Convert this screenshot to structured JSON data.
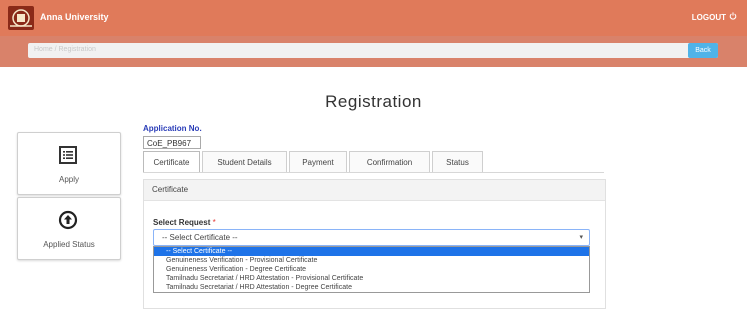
{
  "header": {
    "app_name": "Anna University",
    "logout_label": "LOGOUT",
    "breadcrumb": "Home / Registration",
    "back_label": "Back"
  },
  "page": {
    "title": "Registration"
  },
  "sidebar": [
    {
      "label": "Apply",
      "icon": "list-icon"
    },
    {
      "label": "Applied Status",
      "icon": "upload-circle-icon"
    }
  ],
  "application": {
    "label": "Application No.",
    "value": "CoE_PB967"
  },
  "tabs": [
    "Certificate",
    "Student Details",
    "Payment",
    "Confirmation",
    "Status"
  ],
  "active_tab": "Certificate",
  "panel": {
    "heading": "Certificate",
    "select_label": "Select Request",
    "required_mark": "*",
    "selected_value": "-- Select Certificate --",
    "options": [
      "-- Select Certificate --",
      "Genuineness Verification - Provisional Certificate",
      "Genuineness Verification - Degree Certificate",
      "Tamilnadu Secretariat / HRD Attestation - Provisional Certificate",
      "Tamilnadu Secretariat / HRD Attestation - Degree Certificate"
    ]
  },
  "colors": {
    "header": "#e07a5a",
    "link_blue": "#2a3db8",
    "highlight": "#1e73e8",
    "back_button": "#4fb3e8"
  }
}
